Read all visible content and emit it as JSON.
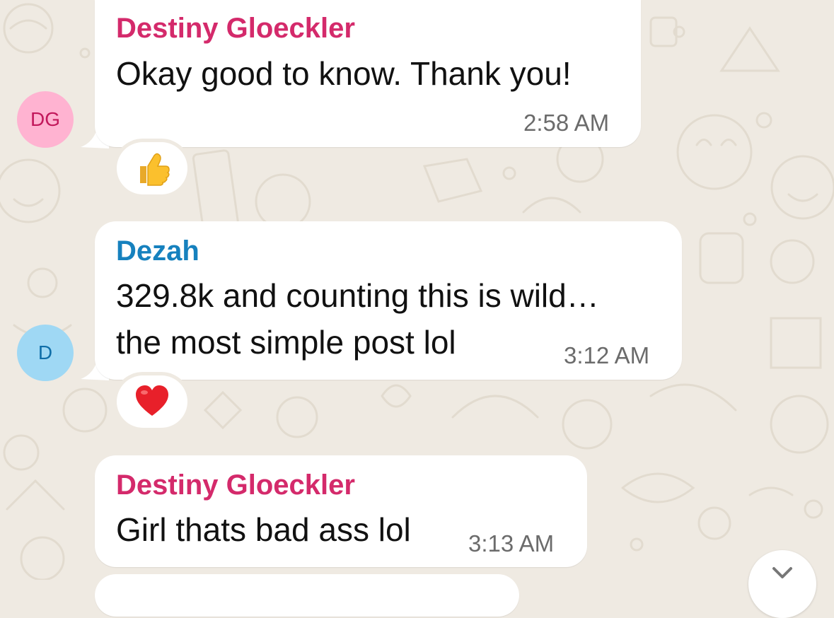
{
  "colors": {
    "background": "#efeae2",
    "sender_pink": "#d42a6b",
    "sender_blue": "#1681be",
    "avatar_dg_bg": "#ffb3d1",
    "avatar_dg_fg": "#c2185b",
    "avatar_d_bg": "#9fd8f4",
    "avatar_d_fg": "#0f6ea8"
  },
  "messages": [
    {
      "sender": "Destiny Gloeckler",
      "avatar_initials": "DG",
      "lines": [
        "Okay good to know. Thank you!"
      ],
      "time": "2:58 AM",
      "reaction": "thumbs-up"
    },
    {
      "sender": "Dezah",
      "avatar_initials": "D",
      "lines": [
        "329.8k and counting this is wild…",
        "the most simple post lol"
      ],
      "time": "3:12 AM",
      "reaction": "red-heart"
    },
    {
      "sender": "Destiny Gloeckler",
      "lines": [
        "Girl thats bad ass lol"
      ],
      "time": "3:13 AM"
    }
  ],
  "icons": {
    "scroll_down": "chevron-down-icon"
  }
}
